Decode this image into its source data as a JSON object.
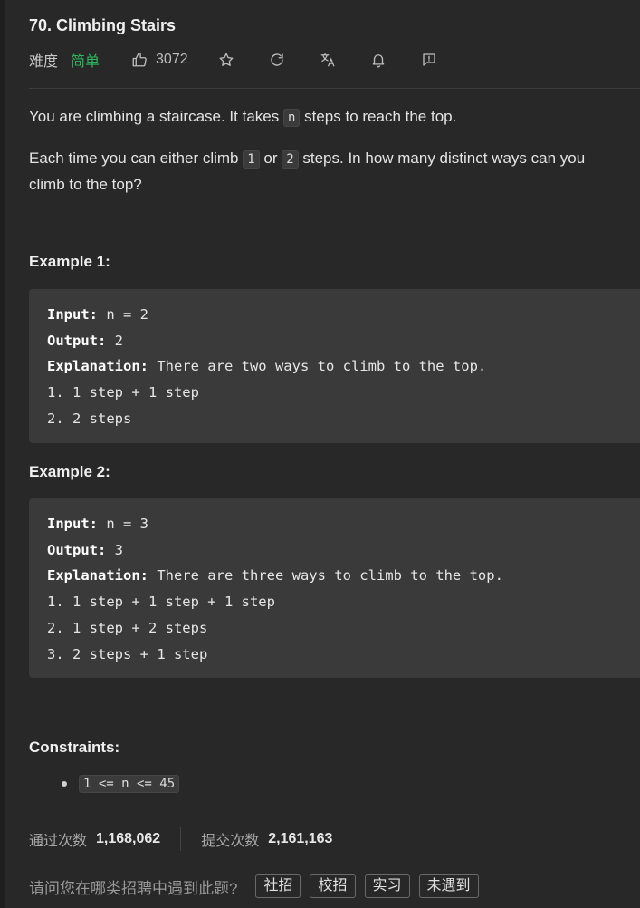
{
  "problem": {
    "title": "70. Climbing Stairs",
    "difficulty_label": "难度",
    "difficulty": "简单",
    "likes": "3072"
  },
  "icons": [
    "thumb-up-icon",
    "star-icon",
    "refresh-icon",
    "translate-icon",
    "bell-icon",
    "feedback-icon"
  ],
  "description": {
    "p1_before": "You are climbing a staircase. It takes ",
    "p1_code": "n",
    "p1_after": " steps to reach the top.",
    "p2_before": "Each time you can either climb ",
    "p2_code1": "1",
    "p2_mid": " or ",
    "p2_code2": "2",
    "p2_after": " steps. In how many distinct ways can you climb to the top?"
  },
  "examples": [
    {
      "heading": "Example 1:",
      "input_label": "Input:",
      "input": " n = 2",
      "output_label": "Output:",
      "output": " 2",
      "explanation_label": "Explanation:",
      "explanation": " There are two ways to climb to the top.",
      "lines": [
        "1. 1 step + 1 step",
        "2. 2 steps"
      ]
    },
    {
      "heading": "Example 2:",
      "input_label": "Input:",
      "input": " n = 3",
      "output_label": "Output:",
      "output": " 3",
      "explanation_label": "Explanation:",
      "explanation": " There are three ways to climb to the top.",
      "lines": [
        "1. 1 step + 1 step + 1 step",
        "2. 1 step + 2 steps",
        "3. 2 steps + 1 step"
      ]
    }
  ],
  "constraints": {
    "heading": "Constraints:",
    "items": [
      "1 <= n <= 45"
    ]
  },
  "stats": {
    "accepted_label": "通过次数",
    "accepted": "1,168,062",
    "submissions_label": "提交次数",
    "submissions": "2,161,163"
  },
  "survey": {
    "question": "请问您在哪类招聘中遇到此题?",
    "options": [
      "社招",
      "校招",
      "实习",
      "未遇到"
    ]
  }
}
